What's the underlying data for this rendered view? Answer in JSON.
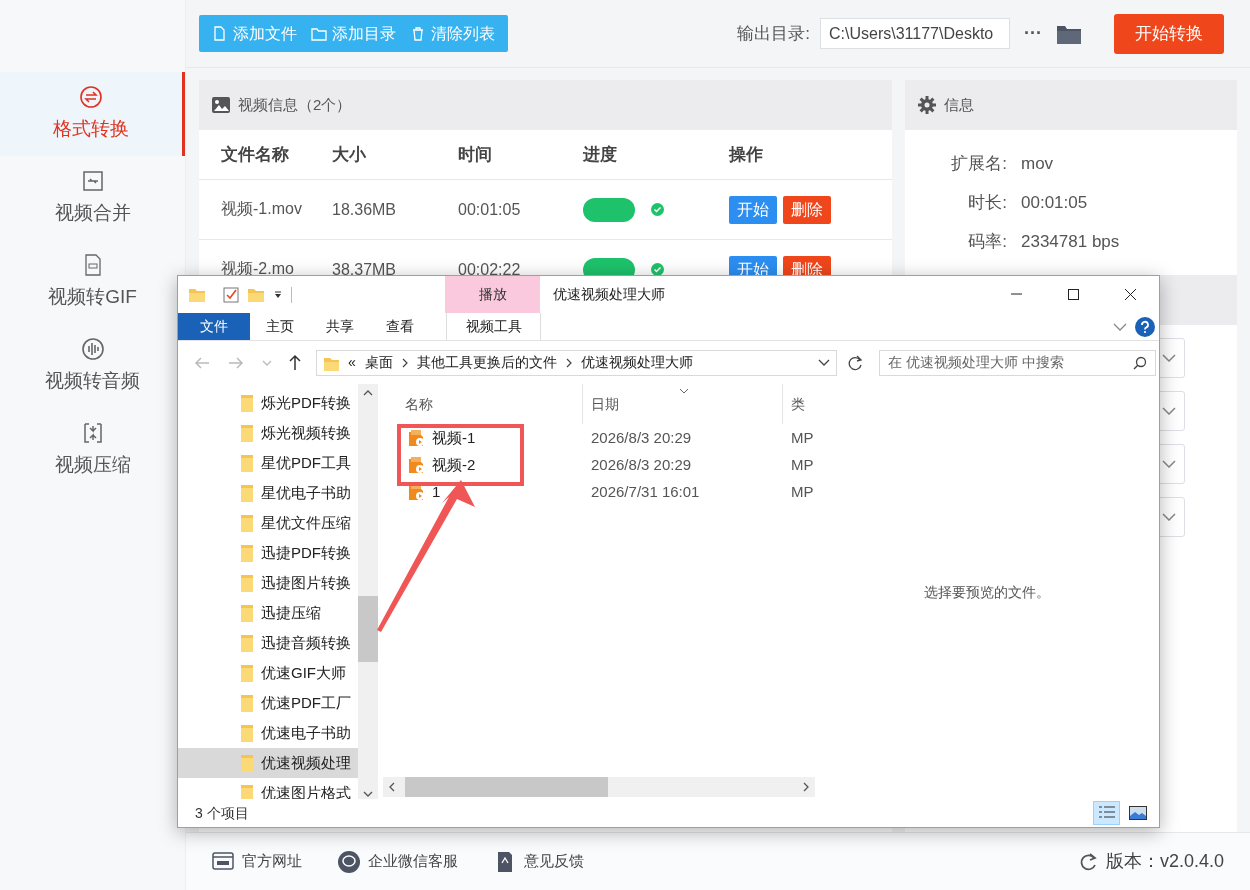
{
  "sidebar": {
    "items": [
      {
        "label": "格式转换",
        "selected": true,
        "kind": "convert"
      },
      {
        "label": "视频合并",
        "selected": false,
        "kind": "merge"
      },
      {
        "label": "视频转GIF",
        "selected": false,
        "kind": "gif"
      },
      {
        "label": "视频转音频",
        "selected": false,
        "kind": "audio"
      },
      {
        "label": "视频压缩",
        "selected": false,
        "kind": "compress"
      }
    ]
  },
  "toolbar": {
    "buttons": [
      {
        "label": "添加文件",
        "kind": "file"
      },
      {
        "label": "添加目录",
        "kind": "folder"
      },
      {
        "label": "清除列表",
        "kind": "trash"
      }
    ],
    "output_label": "输出目录:",
    "output_path": "C:\\Users\\31177\\Deskto",
    "more": "···",
    "start_button": "开始转换"
  },
  "video_panel": {
    "title": "视频信息（2个）",
    "columns": [
      "文件名称",
      "大小",
      "时间",
      "进度",
      "操作"
    ],
    "rows": [
      {
        "name": "视频-1.mov",
        "size": "18.36MB",
        "time": "00:01:05",
        "level": 1,
        "done": true,
        "actions": [
          "开始",
          "删除"
        ]
      },
      {
        "name": "视频-2.mo",
        "size": "38.37MB",
        "time": "00:02:22",
        "level": 1,
        "done": true,
        "actions": [
          "开始",
          "删除"
        ]
      }
    ]
  },
  "info_panel": {
    "title": "信息",
    "fields": [
      {
        "label": "扩展名:",
        "value": "mov"
      },
      {
        "label": "时长:",
        "value": "00:01:05"
      },
      {
        "label": "码率:",
        "value": "2334781 bps"
      }
    ]
  },
  "explorer": {
    "title": "优速视频处理大师",
    "context_header": "播放",
    "ribbon_tabs": [
      {
        "label": "文件",
        "kind": "file"
      },
      {
        "label": "主页",
        "kind": "tab"
      },
      {
        "label": "共享",
        "kind": "tab"
      },
      {
        "label": "查看",
        "kind": "tab"
      },
      {
        "label": "视频工具",
        "kind": "context"
      }
    ],
    "address": {
      "overflow": "«",
      "crumbs": [
        "桌面",
        "其他工具更换后的文件",
        "优速视频处理大师"
      ]
    },
    "search_placeholder": "在 优速视频处理大师 中搜索",
    "tree": [
      {
        "label": "烁光PDF转换",
        "selected": false
      },
      {
        "label": "烁光视频转换",
        "selected": false
      },
      {
        "label": "星优PDF工具",
        "selected": false
      },
      {
        "label": "星优电子书助",
        "selected": false
      },
      {
        "label": "星优文件压缩",
        "selected": false
      },
      {
        "label": "迅捷PDF转换",
        "selected": false
      },
      {
        "label": "迅捷图片转换",
        "selected": false
      },
      {
        "label": "迅捷压缩",
        "selected": false
      },
      {
        "label": "迅捷音频转换",
        "selected": false
      },
      {
        "label": "优速GIF大师",
        "selected": false
      },
      {
        "label": "优速PDF工厂",
        "selected": false
      },
      {
        "label": "优速电子书助",
        "selected": false
      },
      {
        "label": "优速视频处理",
        "selected": true
      },
      {
        "label": "优速图片格式",
        "selected": false
      }
    ],
    "columns": [
      "名称",
      "日期",
      "类"
    ],
    "files": [
      {
        "name": "视频-1",
        "date": "2026/8/3 20:29",
        "type": "MP"
      },
      {
        "name": "视频-2",
        "date": "2026/8/3 20:29",
        "type": "MP"
      },
      {
        "name": "1",
        "date": "2026/7/31 16:01",
        "type": "MP"
      }
    ],
    "preview_text": "选择要预览的文件。",
    "status": "3 个项目"
  },
  "footer": {
    "links": [
      {
        "label": "官方网址",
        "kind": "web"
      },
      {
        "label": "企业微信客服",
        "kind": "chat"
      },
      {
        "label": "意见反馈",
        "kind": "feedback"
      }
    ],
    "version": "版本：v2.0.4.0"
  }
}
